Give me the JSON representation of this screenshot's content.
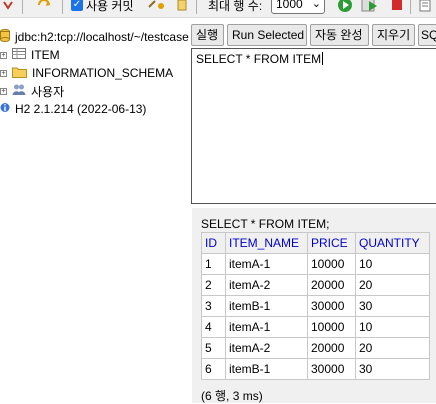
{
  "toolbar": {
    "autocommit_label": "사용 커밋",
    "max_rows_label": "최대 행 수:",
    "max_rows_value": "1000"
  },
  "tree": {
    "connection": "jdbc:h2:tcp://localhost/~/testcase",
    "items": [
      {
        "label": "ITEM"
      },
      {
        "label": "INFORMATION_SCHEMA"
      },
      {
        "label": "사용자"
      }
    ],
    "version": "H2 2.1.214 (2022-06-13)"
  },
  "buttons": {
    "run": "실행",
    "run_selected": "Run Selected",
    "auto_complete": "자동 완성",
    "clear": "지우기",
    "sql_partial": "SQ"
  },
  "editor": {
    "sql": "SELECT * FROM ITEM"
  },
  "results": {
    "query": "SELECT * FROM ITEM;",
    "columns": [
      "ID",
      "ITEM_NAME",
      "PRICE",
      "QUANTITY"
    ],
    "rows": [
      [
        "1",
        "itemA-1",
        "10000",
        "10"
      ],
      [
        "2",
        "itemA-2",
        "20000",
        "20"
      ],
      [
        "3",
        "itemB-1",
        "30000",
        "30"
      ],
      [
        "4",
        "itemA-1",
        "10000",
        "10"
      ],
      [
        "5",
        "itemA-2",
        "20000",
        "20"
      ],
      [
        "6",
        "itemB-1",
        "30000",
        "30"
      ]
    ],
    "status": "(6 행, 3 ms)"
  },
  "colors": {
    "header_text": "#0000cc",
    "run_green": "#2e9c34",
    "stop_red": "#d22b2b"
  }
}
